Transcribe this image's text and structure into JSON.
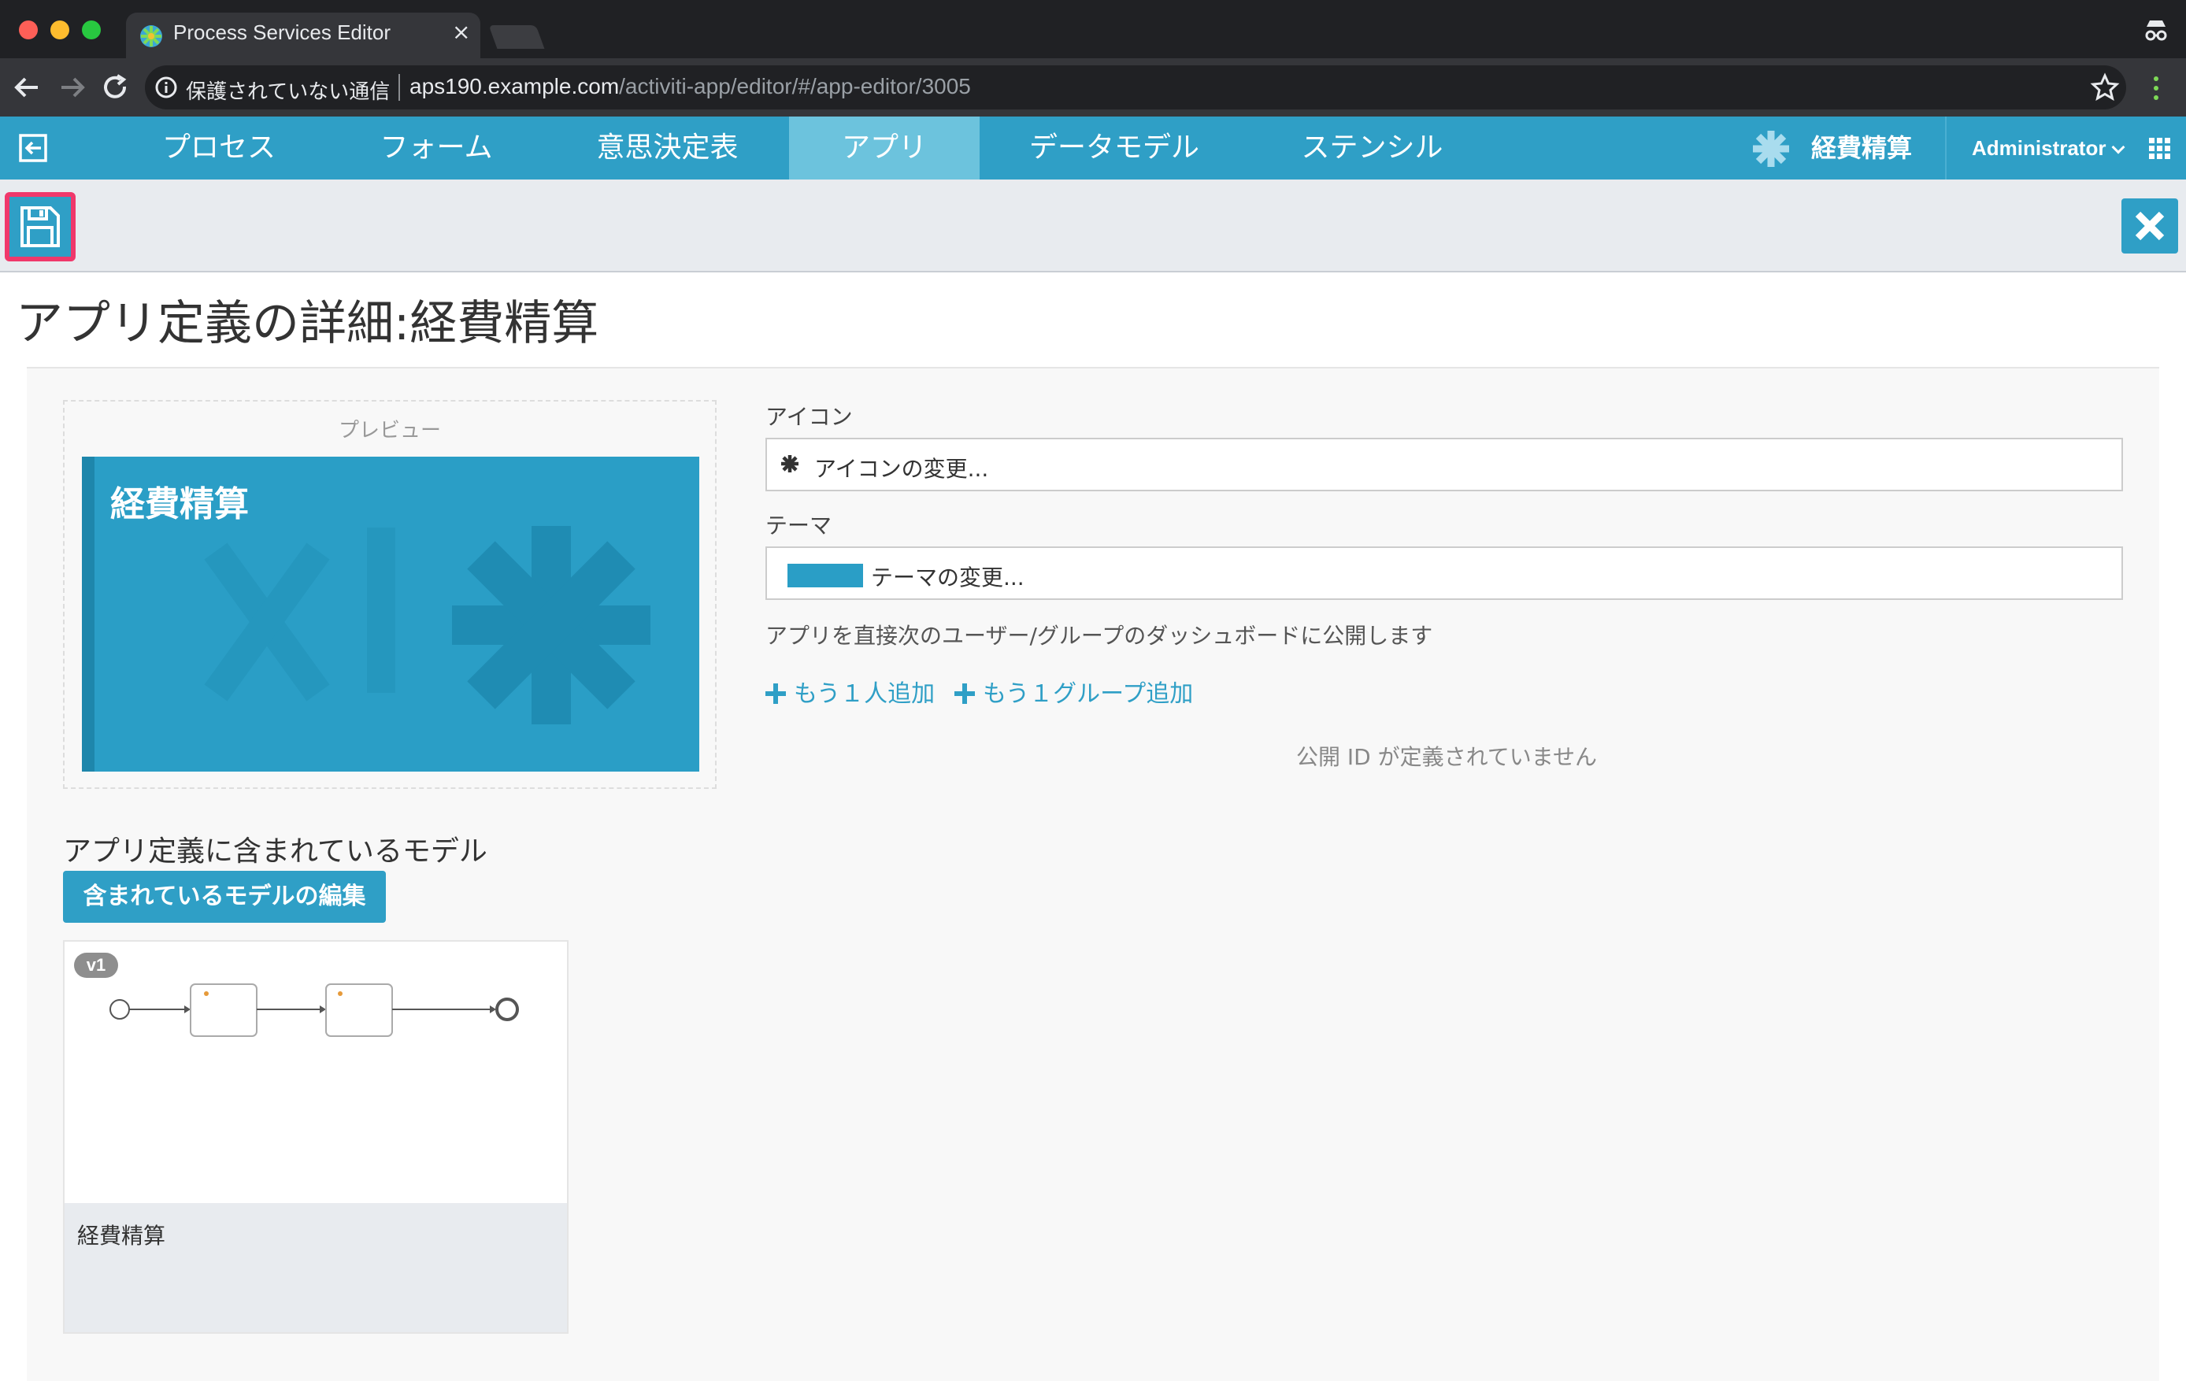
{
  "browser": {
    "tab_title": "Process Services Editor",
    "tab_close": "×",
    "security_label": "保護されていない通信",
    "url_host": "aps190.example.com",
    "url_path": "/activiti-app/editor/#/app-editor/3005"
  },
  "nav": {
    "items": [
      {
        "label": "プロセス"
      },
      {
        "label": "フォーム"
      },
      {
        "label": "意思決定表"
      },
      {
        "label": "アプリ",
        "active": true
      },
      {
        "label": "データモデル"
      },
      {
        "label": "ステンシル"
      }
    ],
    "app_name": "経費精算",
    "user": "Administrator"
  },
  "page": {
    "title": "アプリ定義の詳細:経費精算"
  },
  "preview": {
    "label": "プレビュー",
    "tile_title": "経費精算",
    "theme_color": "#2a9ec6"
  },
  "form": {
    "icon_label": "アイコン",
    "icon_button": "アイコンの変更...",
    "theme_label": "テーマ",
    "theme_button": "テーマの変更...",
    "publish_text": "アプリを直接次のユーザー/グループのダッシュボードに公開します",
    "add_user": "もう１人追加",
    "add_group": "もう１グループ追加",
    "no_id": "公開 ID が定義されていません"
  },
  "models": {
    "heading": "アプリ定義に含まれているモデル",
    "edit_button": "含まれているモデルの編集",
    "items": [
      {
        "version": "v1",
        "name": "経費精算"
      }
    ]
  },
  "colors": {
    "brand": "#2f9fc6",
    "highlight": "#f0386b"
  }
}
